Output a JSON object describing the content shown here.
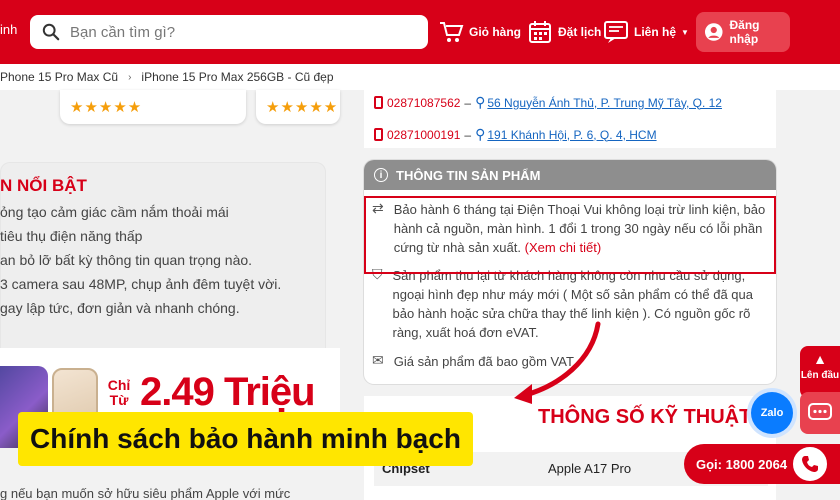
{
  "header": {
    "brand_fragment": "inh",
    "search_placeholder": "Bạn cần tìm gì?",
    "cart_label": "Giỏ hàng",
    "booking_label": "Đặt lịch",
    "contact_label": "Liên hệ",
    "login_label": "Đăng nhập"
  },
  "breadcrumb": {
    "items": [
      "Phone 15 Pro Max Cũ",
      "iPhone 15 Pro Max 256GB - Cũ đẹp"
    ]
  },
  "left": {
    "stars": "★★★★★",
    "feature_title": "N NỔI BẬT",
    "feature_lines": [
      "ỏng tạo cảm giác cầm nắm thoải mái",
      "tiêu thụ điện năng thấp",
      "an bỏ lỡ bất kỳ thông tin quan trọng nào.",
      "3 camera sau 48MP, chụp ảnh đêm tuyệt vời.",
      "gay lập tức, đơn giản và nhanh chóng."
    ],
    "banner_prefix": "Chỉ Từ",
    "banner_price": "2.49 Triệu",
    "bottom_text": "g nếu bạn muốn sở hữu siêu phẩm Apple với mức"
  },
  "stores": [
    {
      "phone": "02871087562",
      "address": "56 Nguyễn Ánh Thủ, P. Trung Mỹ Tây, Q. 12"
    },
    {
      "phone": "02871000191",
      "address": "191 Khánh Hội, P. 6, Q. 4, HCM"
    }
  ],
  "product_info": {
    "title": "THÔNG TIN SẢN PHẨM",
    "warranty": "Bảo hành 6 tháng tại Điện Thoại Vui không loại trừ linh kiện, bảo hành cả nguồn, màn hình. 1 đổi 1 trong 30 ngày nếu có lỗi phần cứng từ nhà sản xuất.",
    "warranty_more": "(Xem chi tiết)",
    "condition": "Sản phẩm thu lại từ khách hàng không còn nhu cầu sử dụng, ngoại hình đẹp như máy mới ( Một số sản phẩm có thể đã qua bảo hành hoặc sửa chữa thay thế linh kiện ). Có nguồn gốc rõ ràng, xuất hoá đơn eVAT.",
    "vat": "Giá sản phẩm đã bao gồm VAT"
  },
  "specs": {
    "title": "THÔNG SỐ KỸ THUẬT",
    "rows": [
      {
        "key": "Chipset",
        "value": "Apple A17 Pro"
      }
    ]
  },
  "caption": "Chính sách bảo hành minh bạch",
  "floating": {
    "to_top": "Lên đầu",
    "zalo": "Zalo",
    "hotline": "Gọi: 1800 2064"
  },
  "colors": {
    "brand_red": "#d70018",
    "caption_yellow": "#ffe600",
    "link_blue": "#1565c0"
  }
}
